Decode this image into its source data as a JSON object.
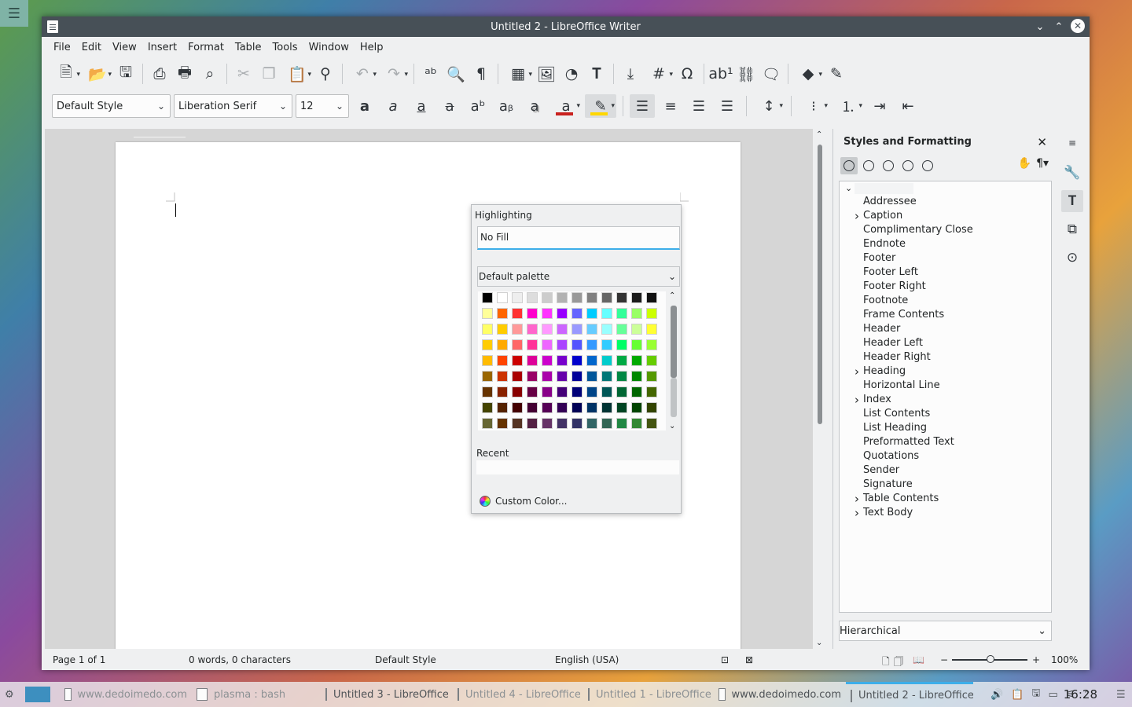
{
  "window": {
    "title": "Untitled 2 - LibreOffice Writer"
  },
  "menu": [
    "File",
    "Edit",
    "View",
    "Insert",
    "Format",
    "Table",
    "Tools",
    "Window",
    "Help"
  ],
  "format_bar": {
    "paragraph_style": "Default Style",
    "font_name": "Liberation Serif",
    "font_size": "12",
    "font_color": "#c9211e",
    "highlight_color": "#ffd700"
  },
  "highlight_popup": {
    "title": "Highlighting",
    "no_fill": "No Fill",
    "palette": "Default palette",
    "recent_label": "Recent",
    "custom_color": "Custom Color...",
    "swatch_rows": [
      [
        "#000000",
        "#ffffff",
        "#eeeeee",
        "#dddddd",
        "#cccccc",
        "#b2b2b2",
        "#999999",
        "#808080",
        "#666666",
        "#333333",
        "#1c1c1c",
        "#111111"
      ],
      [
        "#ffff99",
        "#ff6600",
        "#ff3333",
        "#ff00cc",
        "#ff33ff",
        "#9900ff",
        "#6666ff",
        "#00ccff",
        "#66ffff",
        "#33ff99",
        "#99ff66",
        "#ccff00"
      ],
      [
        "#ffff66",
        "#ffcc00",
        "#ff9999",
        "#ff66cc",
        "#ff99ff",
        "#cc66ff",
        "#9999ff",
        "#66ccff",
        "#99ffff",
        "#66ff99",
        "#ccff99",
        "#ffff33"
      ],
      [
        "#ffcc00",
        "#ffaa00",
        "#ff6666",
        "#ff3399",
        "#ee66ff",
        "#aa44ff",
        "#5555ff",
        "#3399ff",
        "#33ccff",
        "#00ff66",
        "#66ff33",
        "#99ff33"
      ],
      [
        "#ffbb00",
        "#ff4400",
        "#cc0000",
        "#dd0099",
        "#cc00cc",
        "#7700cc",
        "#0000cc",
        "#0066cc",
        "#00cccc",
        "#00aa44",
        "#00aa00",
        "#66cc00"
      ],
      [
        "#996600",
        "#cc3300",
        "#aa0000",
        "#990066",
        "#aa00aa",
        "#6600aa",
        "#000099",
        "#005599",
        "#007777",
        "#008844",
        "#008800",
        "#559900"
      ],
      [
        "#663300",
        "#882200",
        "#880000",
        "#660044",
        "#880088",
        "#440077",
        "#000077",
        "#004488",
        "#005555",
        "#006633",
        "#006600",
        "#446600"
      ],
      [
        "#444400",
        "#552200",
        "#440000",
        "#440033",
        "#550055",
        "#330055",
        "#000055",
        "#003366",
        "#003333",
        "#004422",
        "#004400",
        "#334400"
      ],
      [
        "#666633",
        "#663300",
        "#553322",
        "#552244",
        "#663366",
        "#443366",
        "#333366",
        "#336666",
        "#336655",
        "#228844",
        "#338833",
        "#445511"
      ]
    ]
  },
  "sidebar": {
    "title": "Styles and Formatting",
    "styles": [
      {
        "name": "Addressee",
        "expandable": false
      },
      {
        "name": "Caption",
        "expandable": true
      },
      {
        "name": "Complimentary Close",
        "expandable": false
      },
      {
        "name": "Endnote",
        "expandable": false
      },
      {
        "name": "Footer",
        "expandable": false
      },
      {
        "name": "Footer Left",
        "expandable": false
      },
      {
        "name": "Footer Right",
        "expandable": false
      },
      {
        "name": "Footnote",
        "expandable": false
      },
      {
        "name": "Frame Contents",
        "expandable": false
      },
      {
        "name": "Header",
        "expandable": false
      },
      {
        "name": "Header Left",
        "expandable": false
      },
      {
        "name": "Header Right",
        "expandable": false
      },
      {
        "name": "Heading",
        "expandable": true
      },
      {
        "name": "Horizontal Line",
        "expandable": false
      },
      {
        "name": "Index",
        "expandable": true
      },
      {
        "name": "List Contents",
        "expandable": false
      },
      {
        "name": "List Heading",
        "expandable": false
      },
      {
        "name": "Preformatted Text",
        "expandable": false
      },
      {
        "name": "Quotations",
        "expandable": false
      },
      {
        "name": "Sender",
        "expandable": false
      },
      {
        "name": "Signature",
        "expandable": false
      },
      {
        "name": "Table Contents",
        "expandable": true
      },
      {
        "name": "Text Body",
        "expandable": true
      }
    ],
    "filter": "Hierarchical"
  },
  "status": {
    "page": "Page 1 of 1",
    "words": "0 words, 0 characters",
    "style": "Default Style",
    "language": "English (USA)",
    "zoom": "100%"
  },
  "taskbar": {
    "items": [
      {
        "label": "www.dedoimedo.com",
        "dim": true
      },
      {
        "label": "plasma : bash",
        "dim": true
      },
      {
        "label": "Untitled 3 - LibreOffice",
        "dim": false
      },
      {
        "label": "Untitled 4 - LibreOffice",
        "dim": true
      },
      {
        "label": "Untitled 1 - LibreOffice",
        "dim": true
      },
      {
        "label": "www.dedoimedo.com",
        "dim": false
      },
      {
        "label": "Untitled 2 - LibreOffice",
        "dim": false
      }
    ],
    "clock": "16:28"
  }
}
